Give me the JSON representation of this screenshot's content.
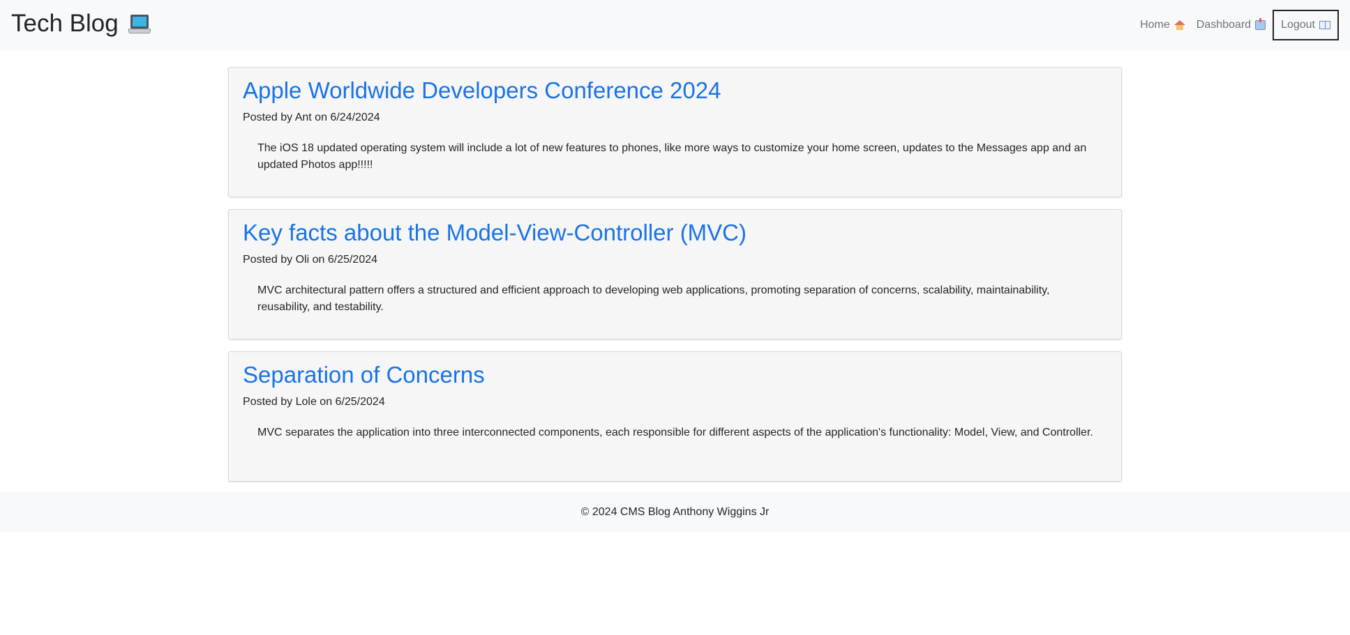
{
  "header": {
    "brand": "Tech Blog",
    "brand_icon": "laptop-icon",
    "nav": {
      "home_label": "Home",
      "home_icon": "house-icon",
      "dashboard_label": "Dashboard",
      "dashboard_icon": "inbox-tray-icon",
      "logout_label": "Logout",
      "logout_icon": "open-book-icon"
    }
  },
  "posts": [
    {
      "title": "Apple Worldwide Developers Conference 2024",
      "meta": "Posted by Ant on 6/24/2024",
      "body": "The iOS 18 updated operating system will include a lot of new features to phones, like more ways to customize your home screen, updates to the Messages app and an updated Photos app!!!!!"
    },
    {
      "title": "Key facts about the Model-View-Controller (MVC)",
      "meta": "Posted by Oli on 6/25/2024",
      "body": "MVC architectural pattern offers a structured and efficient approach to developing web applications, promoting separation of concerns, scalability, maintainability, reusability, and testability."
    },
    {
      "title": "Separation of Concerns",
      "meta": "Posted by Lole on 6/25/2024",
      "body": "MVC separates the application into three interconnected components, each responsible for different aspects of the application's functionality: Model, View, and Controller."
    }
  ],
  "footer": {
    "text": "© 2024 CMS Blog Anthony Wiggins Jr"
  },
  "colors": {
    "navbar_bg": "#f8f9fa",
    "link_blue": "#1a73e8",
    "card_bg": "#f6f6f6"
  }
}
